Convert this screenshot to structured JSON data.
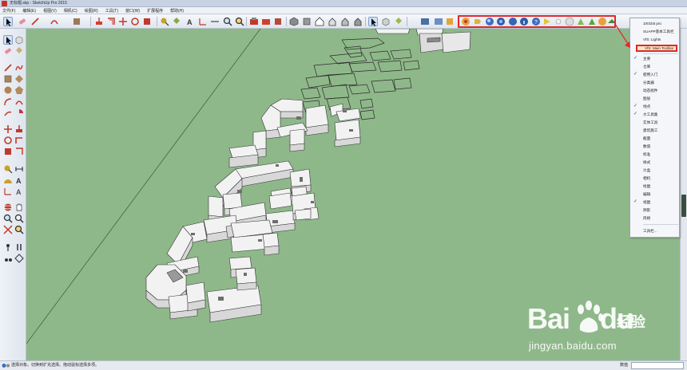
{
  "window": {
    "title": "无标题.skp - SketchUp Pro 2015"
  },
  "menu": [
    "文件(F)",
    "编辑(E)",
    "视图(V)",
    "相机(C)",
    "绘图(R)",
    "工具(T)",
    "窗口(W)",
    "扩展程序",
    "帮助(H)"
  ],
  "toolbar_menu": {
    "items": [
      {
        "label": "1001bit pro",
        "checked": false
      },
      {
        "label": "SUAPP基本工具栏",
        "checked": false
      },
      {
        "label": "VfS: Lights",
        "checked": false
      },
      {
        "label": "VfS: Main Toolbar",
        "checked": true,
        "highlighted": true
      },
      {
        "label": "主要",
        "checked": true
      },
      {
        "label": "仓库",
        "checked": false
      },
      {
        "label": "使用入门",
        "checked": true
      },
      {
        "label": "分类器",
        "checked": false
      },
      {
        "label": "动态组件",
        "checked": false
      },
      {
        "label": "图层",
        "checked": false
      },
      {
        "label": "地点",
        "checked": true
      },
      {
        "label": "大工具集",
        "checked": true
      },
      {
        "label": "实体工具",
        "checked": false
      },
      {
        "label": "建筑施工",
        "checked": false
      },
      {
        "label": "截面",
        "checked": false
      },
      {
        "label": "数值",
        "checked": false
      },
      {
        "label": "标准",
        "checked": false
      },
      {
        "label": "样式",
        "checked": false
      },
      {
        "label": "沙盒",
        "checked": false
      },
      {
        "label": "相机",
        "checked": false
      },
      {
        "label": "绘图",
        "checked": false
      },
      {
        "label": "编辑",
        "checked": false
      },
      {
        "label": "视图",
        "checked": true
      },
      {
        "label": "阴影",
        "checked": false
      },
      {
        "label": "风格",
        "checked": false
      },
      {
        "label": "工具栏...",
        "checked": false
      }
    ]
  },
  "status": {
    "hint": "选择对象。切换到扩充选择。拖动鼠标选择多项。",
    "measurement_label": "数值",
    "measurement_value": ""
  },
  "watermark": {
    "brand": "Bai",
    "brand_suffix": "du",
    "cn": "经验",
    "url": "jingyan.baidu.com"
  },
  "colors": {
    "viewport_bg": "#8fb88a",
    "highlight": "#e0282a",
    "building": "#eeeeee"
  }
}
